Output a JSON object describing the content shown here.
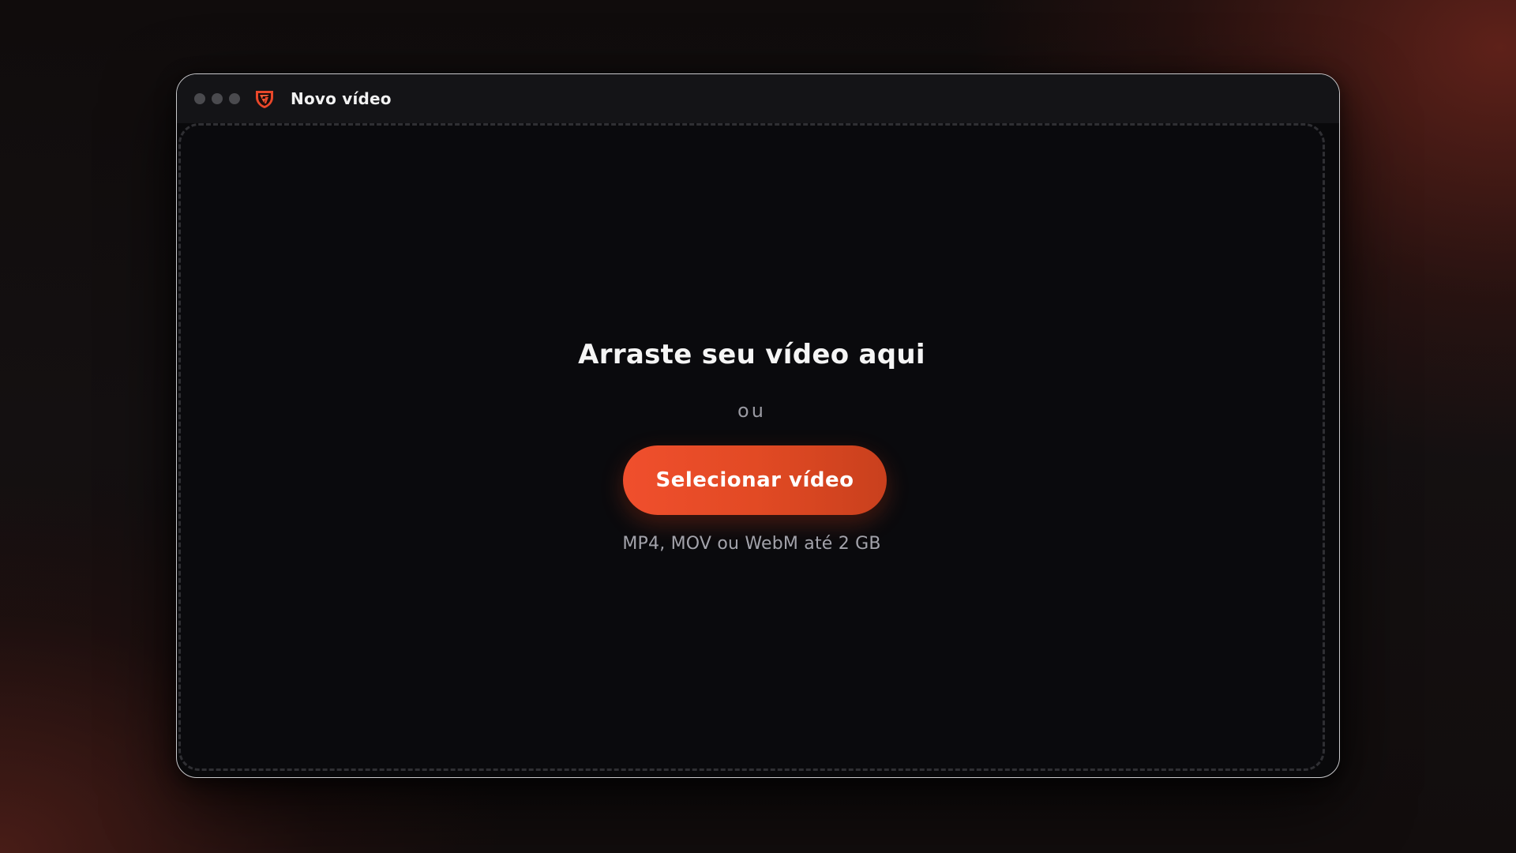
{
  "window": {
    "title": "Novo vídeo",
    "logo_icon": "shield-logo-icon",
    "traffic_lights": [
      "close",
      "minimize",
      "maximize"
    ]
  },
  "dropzone": {
    "heading": "Arraste seu vídeo aqui",
    "separator": "ou",
    "button_label": "Selecionar vídeo",
    "hint": "MP4, MOV ou WebM até 2 GB"
  },
  "colors": {
    "accent": "#e94b26",
    "accent_dark": "#c9401d",
    "window_bg": "#09090b",
    "titlebar_bg": "#141417",
    "text_primary": "#f5f5f5",
    "text_muted": "#a3a3ab"
  }
}
